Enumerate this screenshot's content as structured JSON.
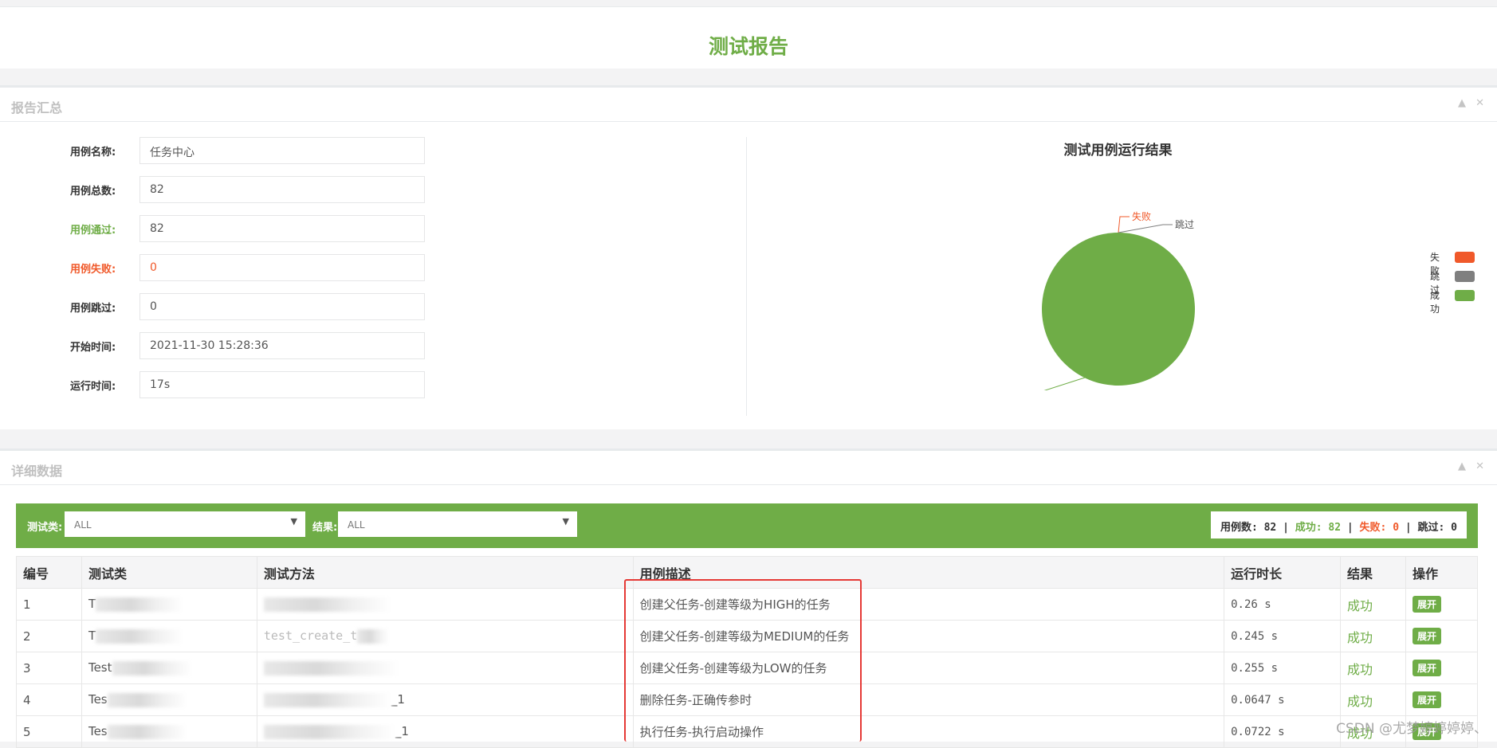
{
  "page": {
    "title": "测试报告"
  },
  "summary": {
    "title": "报告汇总",
    "tools": {
      "collapse": "▲",
      "close": "✕"
    },
    "fields": [
      {
        "label": "用例名称:",
        "value": "任务中心"
      },
      {
        "label": "用例总数:",
        "value": "82"
      },
      {
        "label": "用例通过:",
        "value": "82"
      },
      {
        "label": "用例失败:",
        "value": "0"
      },
      {
        "label": "用例跳过:",
        "value": "0"
      },
      {
        "label": "开始时间:",
        "value": "2021-11-30 15:28:36"
      },
      {
        "label": "运行时间:",
        "value": "17s"
      }
    ]
  },
  "chart_data": {
    "type": "pie",
    "title": "测试用例运行结果",
    "slices": [
      {
        "name": "失败",
        "value": 0,
        "color": "#f0592a"
      },
      {
        "name": "跳过",
        "value": 0,
        "color": "#7f7f7f"
      },
      {
        "name": "成功",
        "value": 82,
        "color": "#6fad47"
      }
    ],
    "legend_position": "right"
  },
  "detail": {
    "title": "详细数据",
    "tools": {
      "collapse": "▲",
      "close": "✕"
    },
    "filters": {
      "class_label": "测试类:",
      "class_value": "ALL",
      "result_label": "结果:",
      "result_value": "ALL"
    },
    "stats": {
      "total_label": "用例数:",
      "total": "82",
      "pass_label": "成功:",
      "pass": "82",
      "fail_label": "失败:",
      "fail": "0",
      "skip_label": "跳过:",
      "skip": "0",
      "sep": "|"
    },
    "columns": [
      "编号",
      "测试类",
      "测试方法",
      "用例描述",
      "运行时长",
      "结果",
      "操作"
    ],
    "rows": [
      {
        "id": "1",
        "cls": "T",
        "method": "",
        "desc": "创建父任务-创建等级为HIGH的任务",
        "dur": "0.26 s",
        "result": "成功",
        "action": "展开"
      },
      {
        "id": "2",
        "cls": "T",
        "method": "test_create_t",
        "desc": "创建父任务-创建等级为MEDIUM的任务",
        "dur": "0.245 s",
        "result": "成功",
        "action": "展开"
      },
      {
        "id": "3",
        "cls": "Test",
        "method": "",
        "desc": "创建父任务-创建等级为LOW的任务",
        "dur": "0.255 s",
        "result": "成功",
        "action": "展开"
      },
      {
        "id": "4",
        "cls": "Tes",
        "method": "_1",
        "desc": "删除任务-正确传参时",
        "dur": "0.0647 s",
        "result": "成功",
        "action": "展开"
      },
      {
        "id": "5",
        "cls": "Tes",
        "method": "_1",
        "desc": "执行任务-执行启动操作",
        "dur": "0.0722 s",
        "result": "成功",
        "action": "展开"
      }
    ]
  },
  "watermark": "CSDN @尤梦婷婷婷婷、"
}
